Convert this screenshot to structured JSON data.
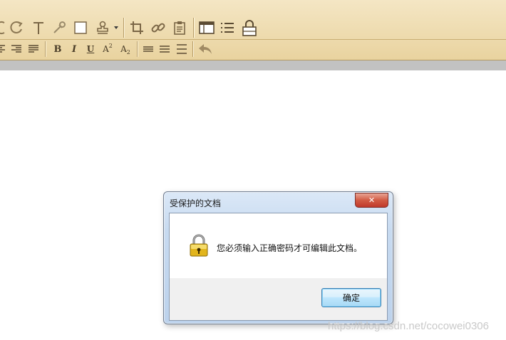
{
  "toolbar": {
    "row2_text_buttons": {
      "bold": "B",
      "italic": "I",
      "underline": "U",
      "superscript": "A",
      "superscript_mark": "2",
      "subscript": "A",
      "subscript_mark": "2"
    }
  },
  "dialog": {
    "title": "受保护的文档",
    "close_glyph": "✕",
    "message": "您必须输入正确密码才可编辑此文档。",
    "ok_label": "确定"
  },
  "watermark": "https://blog.csdn.net/cocowei0306"
}
